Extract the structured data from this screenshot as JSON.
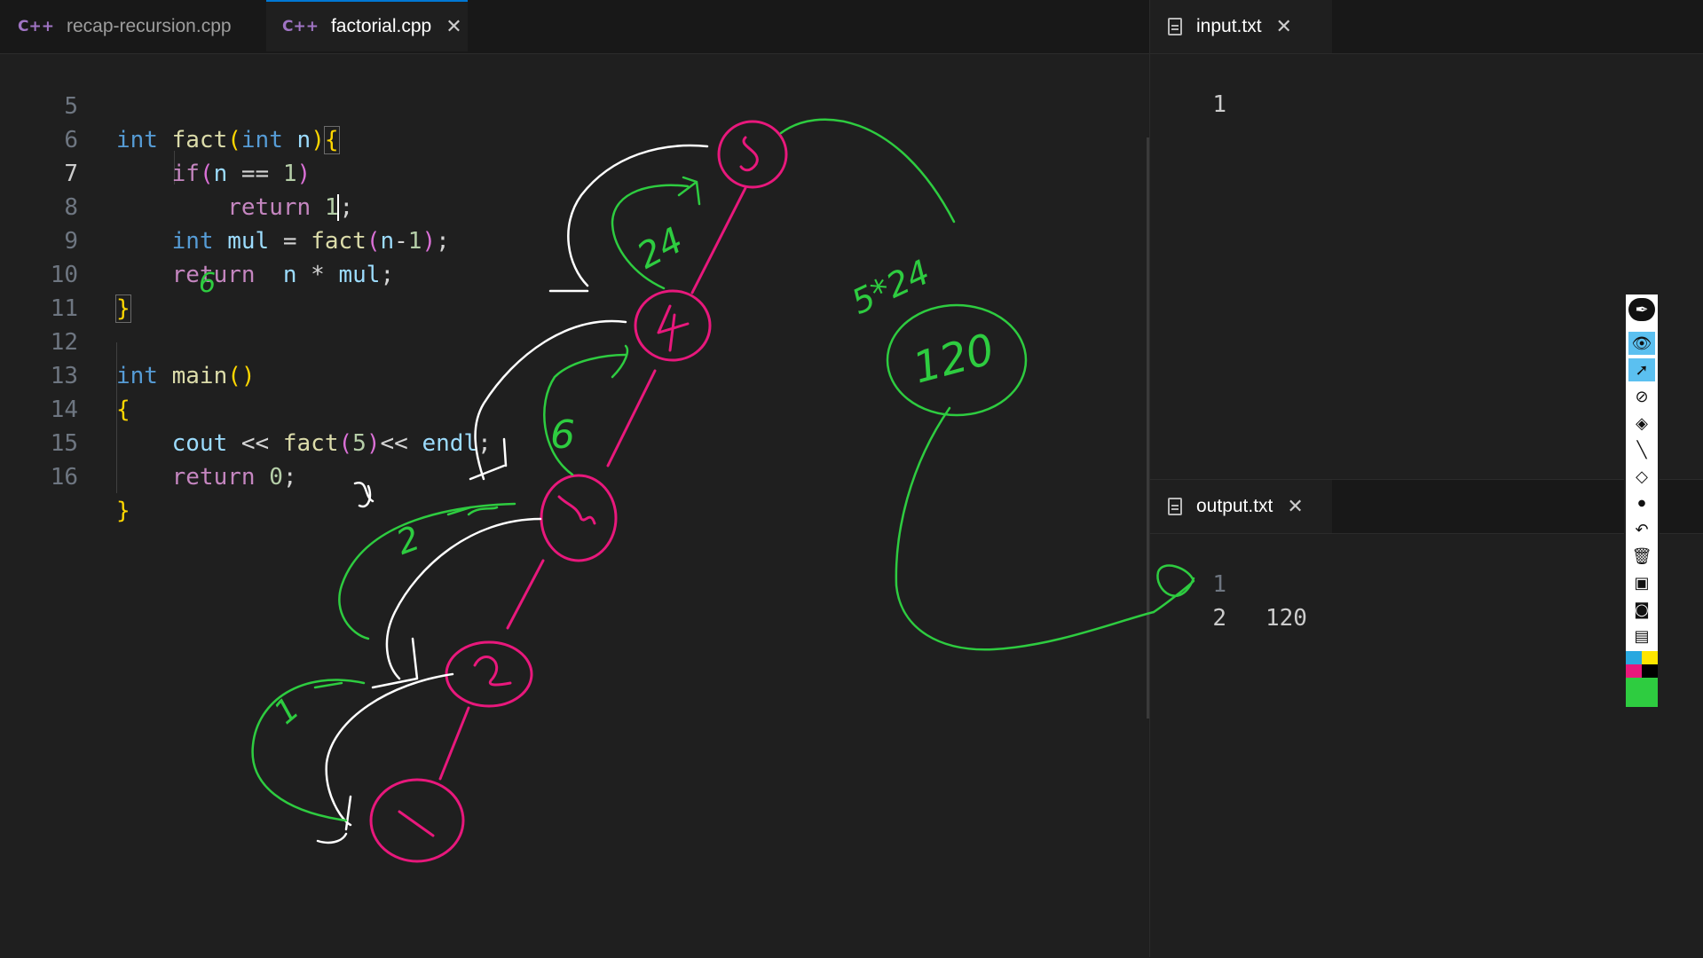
{
  "editor": {
    "tabs": [
      {
        "label": "recap-recursion.cpp",
        "icon": "cpp-icon",
        "lang": "C++",
        "active": false
      },
      {
        "label": "factorial.cpp",
        "icon": "cpp-icon",
        "lang": "C++",
        "active": true,
        "close": "✕"
      }
    ],
    "line_numbers": [
      "5",
      "6",
      "7",
      "8",
      "9",
      "10",
      "11",
      "12",
      "13",
      "14",
      "15",
      "16"
    ]
  },
  "input_pane": {
    "tab": {
      "label": "input.txt",
      "close": "✕"
    },
    "lines": [
      {
        "n": "1",
        "text": ""
      }
    ]
  },
  "output_pane": {
    "tab": {
      "label": "output.txt",
      "close": "✕"
    },
    "lines": [
      {
        "n": "1",
        "text": "120"
      },
      {
        "n": "2",
        "text": ""
      }
    ]
  },
  "annotations": {
    "white": "#ffffff",
    "green": "#2ecc40",
    "pink": "#e8187c",
    "numbers": [
      "5",
      "4",
      "3",
      "2",
      "1",
      "24",
      "6",
      "2",
      "1",
      "5*24",
      "120",
      "6",
      "5"
    ]
  },
  "toolbar": {
    "tools": [
      "pen-icon",
      "eye-icon",
      "pointer-icon",
      "laser-icon",
      "highlighter-icon",
      "line-icon",
      "eraser-icon",
      "dot-icon",
      "undo-icon",
      "trash-icon",
      "whiteboard-icon",
      "camera-icon",
      "clipboard-icon",
      "color-palette-icon"
    ],
    "colors": [
      "#29a8e0",
      "#ffe600",
      "#e8187c",
      "#000000",
      "#2ecc40"
    ]
  }
}
